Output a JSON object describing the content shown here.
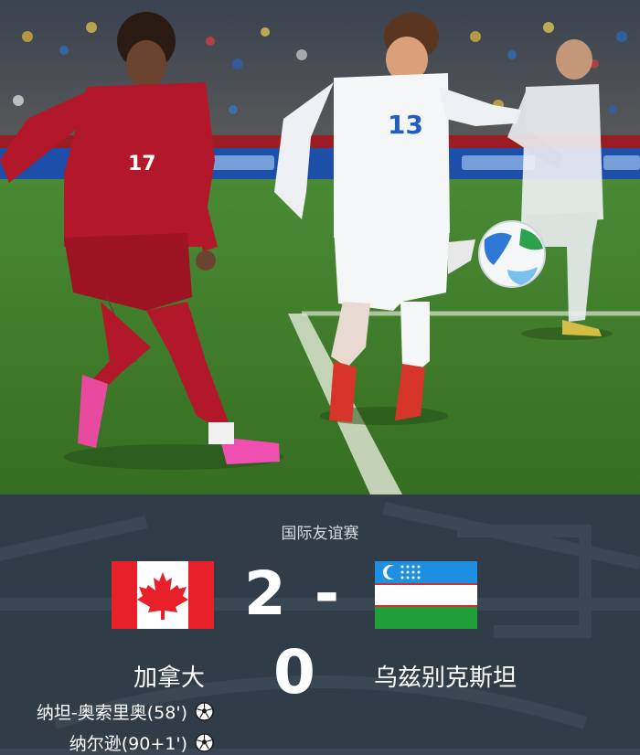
{
  "match": {
    "competition": "国际友谊赛",
    "home_team": "加拿大",
    "away_team": "乌兹别克斯坦",
    "home_score": "2",
    "away_score": "0",
    "separator": "-",
    "scorers": [
      {
        "text": "纳坦-奥索里奥(58')",
        "icon": "soccer-ball-icon"
      },
      {
        "text": "纳尔逊(90+1')",
        "icon": "soccer-ball-icon"
      }
    ]
  },
  "photo": {
    "home_player_number": "17",
    "away_player_number": "13",
    "colors": {
      "canada_kit": "#b3172a",
      "uzbekistan_kit": "#f4f6f8",
      "pitch": "#3f7a2a"
    }
  },
  "colors": {
    "card_bg": "#303c48",
    "canada_red": "#e8202a",
    "uzbek_blue": "#1e8fe1",
    "uzbek_green": "#1f9e3a"
  }
}
